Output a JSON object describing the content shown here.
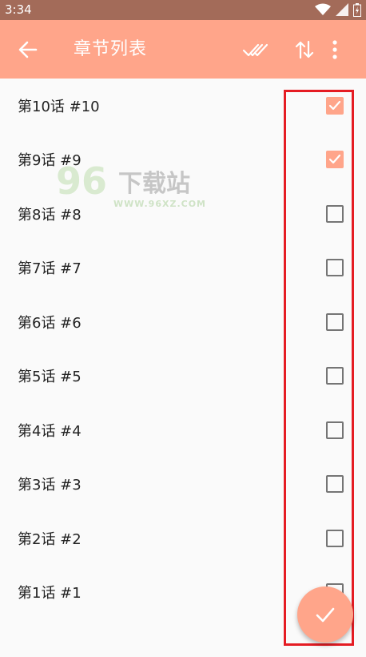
{
  "status_bar": {
    "time": "3:34",
    "icons": [
      "wifi-icon",
      "signal-icon",
      "battery-icon"
    ]
  },
  "toolbar": {
    "title": "章节列表",
    "back_icon": "arrow-left-icon",
    "actions": [
      "double-check-icon",
      "sort-icon",
      "more-vert-icon"
    ]
  },
  "chapters": [
    {
      "label": "第10话 #10",
      "checked": true
    },
    {
      "label": "第9话 #9",
      "checked": true
    },
    {
      "label": "第8话 #8",
      "checked": false
    },
    {
      "label": "第7话 #7",
      "checked": false
    },
    {
      "label": "第6话 #6",
      "checked": false
    },
    {
      "label": "第5话 #5",
      "checked": false
    },
    {
      "label": "第4话 #4",
      "checked": false
    },
    {
      "label": "第3话 #3",
      "checked": false
    },
    {
      "label": "第2话 #2",
      "checked": false
    },
    {
      "label": "第1话 #1",
      "checked": false
    }
  ],
  "watermark": {
    "number": "96",
    "brand": "下载站",
    "url": "WWW.96XZ.COM"
  },
  "fab": {
    "icon": "check-icon"
  },
  "colors": {
    "accent": "#ffa58a",
    "status_bar": "#a36b59",
    "highlight": "#e51c23"
  }
}
